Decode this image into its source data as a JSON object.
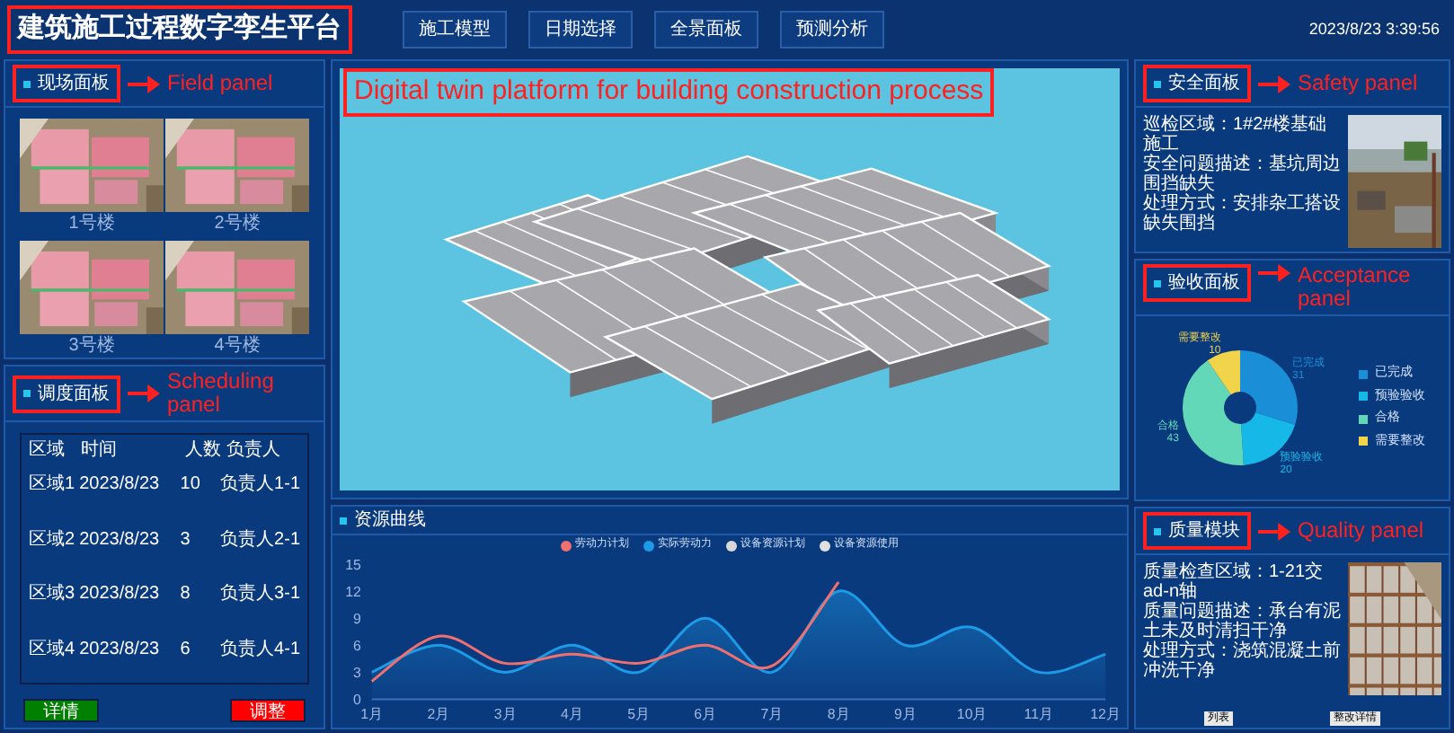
{
  "header": {
    "title": "建筑施工过程数字孪生平台",
    "nav": [
      {
        "label": "施工模型"
      },
      {
        "label": "日期选择"
      },
      {
        "label": "全景面板"
      },
      {
        "label": "预测分析"
      }
    ],
    "datetime": "2023/8/23 3:39:56"
  },
  "field_panel": {
    "title": "现场面板",
    "annotation": "Field panel",
    "photos": [
      {
        "caption": "1号楼"
      },
      {
        "caption": "2号楼"
      },
      {
        "caption": "3号楼"
      },
      {
        "caption": "4号楼"
      }
    ]
  },
  "scheduling_panel": {
    "title": "调度面板",
    "annotation": "Scheduling panel",
    "columns": [
      "区域",
      "时间",
      "人数",
      "负责人"
    ],
    "rows": [
      [
        "区域1",
        "2023/8/23",
        "10",
        "负责人1-1"
      ],
      [
        "区域2",
        "2023/8/23",
        "3",
        "负责人2-1"
      ],
      [
        "区域3",
        "2023/8/23",
        "8",
        "负责人3-1"
      ],
      [
        "区域4",
        "2023/8/23",
        "6",
        "负责人4-1"
      ]
    ],
    "buttons": [
      {
        "label": "详情",
        "color": "#008000"
      },
      {
        "label": "调整",
        "color": "#ff0000"
      }
    ]
  },
  "model_view": {
    "annotation": "Digital twin platform for building construction process"
  },
  "resource_panel": {
    "title": "资源曲线",
    "chart_data": {
      "type": "line",
      "legend": "top",
      "categories": [
        "1月",
        "2月",
        "3月",
        "4月",
        "5月",
        "6月",
        "7月",
        "8月",
        "9月",
        "10月",
        "11月",
        "12月"
      ],
      "ylim": [
        0,
        15
      ],
      "yticks": [
        0,
        3,
        6,
        9,
        12,
        15
      ],
      "series": [
        {
          "name": "劳动力计划",
          "color": "#f07070",
          "values": [
            2,
            7,
            4,
            5,
            4,
            6,
            3.7,
            13,
            null,
            null,
            null,
            null
          ]
        },
        {
          "name": "实际劳动力",
          "color": "#1e9be8",
          "type": "area",
          "values": [
            3,
            6,
            3,
            6,
            3,
            9,
            3,
            12,
            6,
            8,
            3,
            5
          ]
        },
        {
          "name": "设备资源计划",
          "color": "#d8d8d8",
          "values": [
            null,
            null,
            null,
            null,
            null,
            null,
            null,
            null,
            null,
            null,
            null,
            null
          ]
        },
        {
          "name": "设备资源使用",
          "color": "#e0e0e0",
          "values": [
            null,
            null,
            null,
            null,
            null,
            null,
            null,
            null,
            null,
            null,
            null,
            null
          ]
        }
      ]
    }
  },
  "safety_panel": {
    "title": "安全面板",
    "annotation": "Safety panel",
    "lines": [
      "巡检区域：1#2#楼基础施工",
      "安全问题描述：基坑周边围挡缺失",
      "处理方式：安排杂工搭设缺失围挡"
    ]
  },
  "acceptance_panel": {
    "title": "验收面板",
    "annotation": "Acceptance panel",
    "chart_data": {
      "type": "donut",
      "categories": [
        "已完成",
        "预验验收",
        "合格",
        "需要整改"
      ],
      "values": [
        31,
        20,
        43,
        10
      ],
      "colors": [
        "#1a8fd8",
        "#16b8e8",
        "#62d8b8",
        "#f2d44a"
      ],
      "value_labels": [
        "31",
        "20",
        "43",
        "10"
      ],
      "legend": "right"
    }
  },
  "quality_panel": {
    "title": "质量模块",
    "annotation": "Quality panel",
    "lines": [
      "质量检查区域：1-21交ad-n轴",
      "质量问题描述：承台有泥土未及时清扫干净",
      "处理方式：浇筑混凝土前冲洗干净"
    ],
    "buttons": [
      {
        "label": "列表"
      },
      {
        "label": "整改详情"
      }
    ]
  }
}
